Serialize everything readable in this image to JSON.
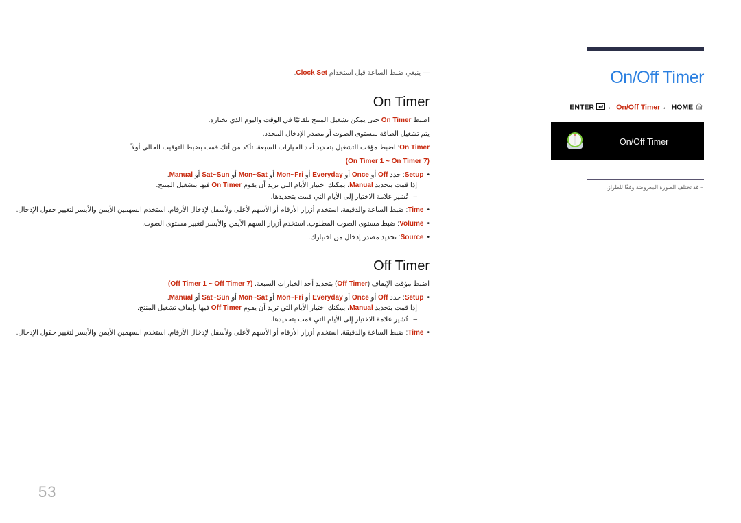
{
  "header": {
    "title": "On/Off Timer"
  },
  "nav": {
    "enter": "ENTER",
    "arrow1": "←",
    "item": "On/Off Timer",
    "arrow2": "←",
    "home": "HOME",
    "enter_icon": "enter-icon",
    "home_icon": "home-icon"
  },
  "menu_preview": {
    "icon": "timer-knob-icon",
    "label": "On/Off Timer"
  },
  "side_note": "– قد تختلف الصورة المعروضة وفقًا للطراز.",
  "note_top": {
    "prefix": "— ينبغي ضبط الساعة قبل استخدام ",
    "keyword": "Clock Set",
    "suffix": "."
  },
  "on_timer": {
    "heading": "On Timer",
    "p1_pre": "اضبط ",
    "p1_kw": "On Timer",
    "p1_post": " حتى يمكن تشغيل المنتج تلقائيًا في الوقت واليوم الذي تختاره.",
    "p2": "يتم تشغيل الطاقة بمستوى الصوت أو مصدر الإدخال المحدد.",
    "p3_kw": "On Timer",
    "p3_post": ": اضبط مؤقت التشغيل بتحديد أحد الخيارات السبعة. تأكد من أنك قمت بضبط التوقيت الحالي أولاً.",
    "range": "(On Timer 1 ~ On Timer 7)",
    "setup": {
      "kw": "Setup",
      "text": ": حدد ",
      "options": [
        "Off",
        "Once",
        "Everyday",
        "Mon~Fri",
        "Mon~Sat",
        "Sat~Sun",
        "Manual"
      ],
      "or": " أو ",
      "end": "."
    },
    "manual_pre": "إذا قمت بتحديد ",
    "manual_kw": "Manual",
    "manual_mid": "، يمكنك اختيار الأيام التي تريد أن يقوم ",
    "manual_kw2": "On Timer",
    "manual_post": " فيها بتشغيل المنتج.",
    "check_note": "تُشير علامة الاختيار إلى الأيام التي قمت بتحديدها.",
    "time_kw": "Time",
    "time_text": ": ضبط الساعة والدقيقة. استخدم أزرار الأرقام أو  الأسهم لأعلى ولأسفل لإدخال الأرقام. استخدم السهمين الأيمن والأيسر لتغيير حقول الإدخال.",
    "volume_kw": "Volume",
    "volume_text": ": ضبط مستوى الصوت المطلوب. استخدم أزرار السهم الأيمن والأيسر لتغيير مستوى الصوت.",
    "source_kw": "Source",
    "source_text": ": تحديد مصدر إدخال من اختيارك."
  },
  "off_timer": {
    "heading": "Off Timer",
    "p1_pre": "اضبط مؤقت الإيقاف (",
    "p1_kw": "Off Timer",
    "p1_post": ") بتحديد أحد الخيارات السبعة. ",
    "range": "(Off Timer 1 ~ Off Timer 7)",
    "setup": {
      "kw": "Setup",
      "text": ": حدد ",
      "options": [
        "Off",
        "Once",
        "Everyday",
        "Mon~Fri",
        "Mon~Sat",
        "Sat~Sun",
        "Manual"
      ],
      "or": " أو ",
      "end": "."
    },
    "manual_pre": "إذا قمت بتحديد ",
    "manual_kw": "Manual",
    "manual_mid": "، يمكنك اختيار الأيام التي تريد أن يقوم ",
    "manual_kw2": "Off Timer",
    "manual_post": " فيها بإيقاف تشغيل المنتج.",
    "check_note": "تُشير علامة الاختيار إلى الأيام التي قمت بتحديدها.",
    "time_kw": "Time",
    "time_text": ": ضبط الساعة والدقيقة. استخدم أزرار الأرقام أو  الأسهم لأعلى ولأسفل لإدخال الأرقام. استخدم السهمين الأيمن والأيسر لتغيير حقول الإدخال."
  },
  "page_number": "53"
}
